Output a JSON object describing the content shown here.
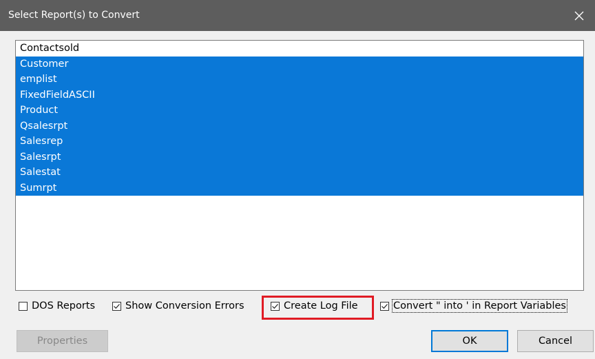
{
  "dialog": {
    "title": "Select Report(s) to Convert"
  },
  "reports": [
    {
      "label": "Contactsold",
      "selected": false
    },
    {
      "label": "Customer",
      "selected": true
    },
    {
      "label": "emplist",
      "selected": true
    },
    {
      "label": "FixedFieldASCII",
      "selected": true
    },
    {
      "label": "Product",
      "selected": true
    },
    {
      "label": "Qsalesrpt",
      "selected": true
    },
    {
      "label": "Salesrep",
      "selected": true
    },
    {
      "label": "Salesrpt",
      "selected": true
    },
    {
      "label": "Salestat",
      "selected": true
    },
    {
      "label": "Sumrpt",
      "selected": true
    }
  ],
  "options": {
    "dos_reports": {
      "label": "DOS Reports",
      "checked": false
    },
    "show_errors": {
      "label": "Show Conversion Errors",
      "checked": true
    },
    "create_log": {
      "label": "Create Log File",
      "checked": true
    },
    "convert_quotes": {
      "label": "Convert \" into ' in Report Variables",
      "checked": true
    }
  },
  "buttons": {
    "properties": "Properties",
    "ok": "OK",
    "cancel": "Cancel"
  },
  "colors": {
    "selection": "#0a78d7",
    "highlight_box": "#e01b24",
    "titlebar": "#5d5d5d"
  }
}
